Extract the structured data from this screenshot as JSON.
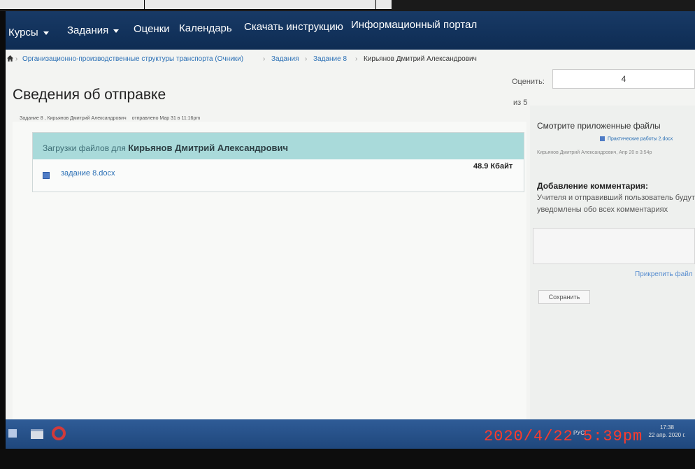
{
  "navbar": {
    "items": [
      {
        "label": "Курсы",
        "dropdown": true
      },
      {
        "label": "Задания",
        "dropdown": true
      },
      {
        "label": "Оценки",
        "dropdown": false
      },
      {
        "label": "Календарь",
        "dropdown": false
      },
      {
        "label": "Скачать инструкцию",
        "dropdown": false
      },
      {
        "label": "Информационный портал",
        "dropdown": false
      }
    ]
  },
  "breadcrumb": {
    "items": [
      "Организационно-производственные структуры транспорта (Очники)",
      "Задания",
      "Задание 8",
      "Кирьянов Дмитрий Александрович"
    ]
  },
  "page": {
    "title": "Сведения об отправке",
    "meta_assignment": "Задание 8 , Кирьянов Дмитрий Александрович",
    "meta_sent": "отправлено Мар 31 в 11:16pm"
  },
  "grade": {
    "label": "Оценить:",
    "value": "4",
    "out_of": "из 5"
  },
  "uploads": {
    "header_prefix": "Загрузки файлов для",
    "student_name": "Кирьянов Дмитрий Александрович",
    "files": [
      {
        "name": "задание 8.docx",
        "size": "48.9 Кбайт",
        "icon": "document-icon"
      }
    ]
  },
  "sidebar": {
    "attachments_title": "Смотрите приложенные файлы",
    "attachment_file": "Практические работы 2.docx",
    "attachment_author": "Кирьянов Дмитрий Александрович, Апр 20 в 3:54p",
    "comment_title": "Добавление комментария:",
    "comment_help": "Учителя и отправивший пользователь будут уведомлены обо всех комментариях",
    "attach_link": "Прикрепить файл",
    "save_label": "Сохранить"
  },
  "taskbar": {
    "language": "РУС",
    "time": "17:38",
    "date": "22 апр. 2020 г."
  },
  "photo_overlay": {
    "date_stamp": "2020/4/22  5:39pm"
  },
  "colors": {
    "navbar": "#183a66",
    "link": "#2a6fb5",
    "uploads_header": "#a9dada",
    "taskbar": "#2f5c97",
    "stamp": "#ff3b2b"
  }
}
